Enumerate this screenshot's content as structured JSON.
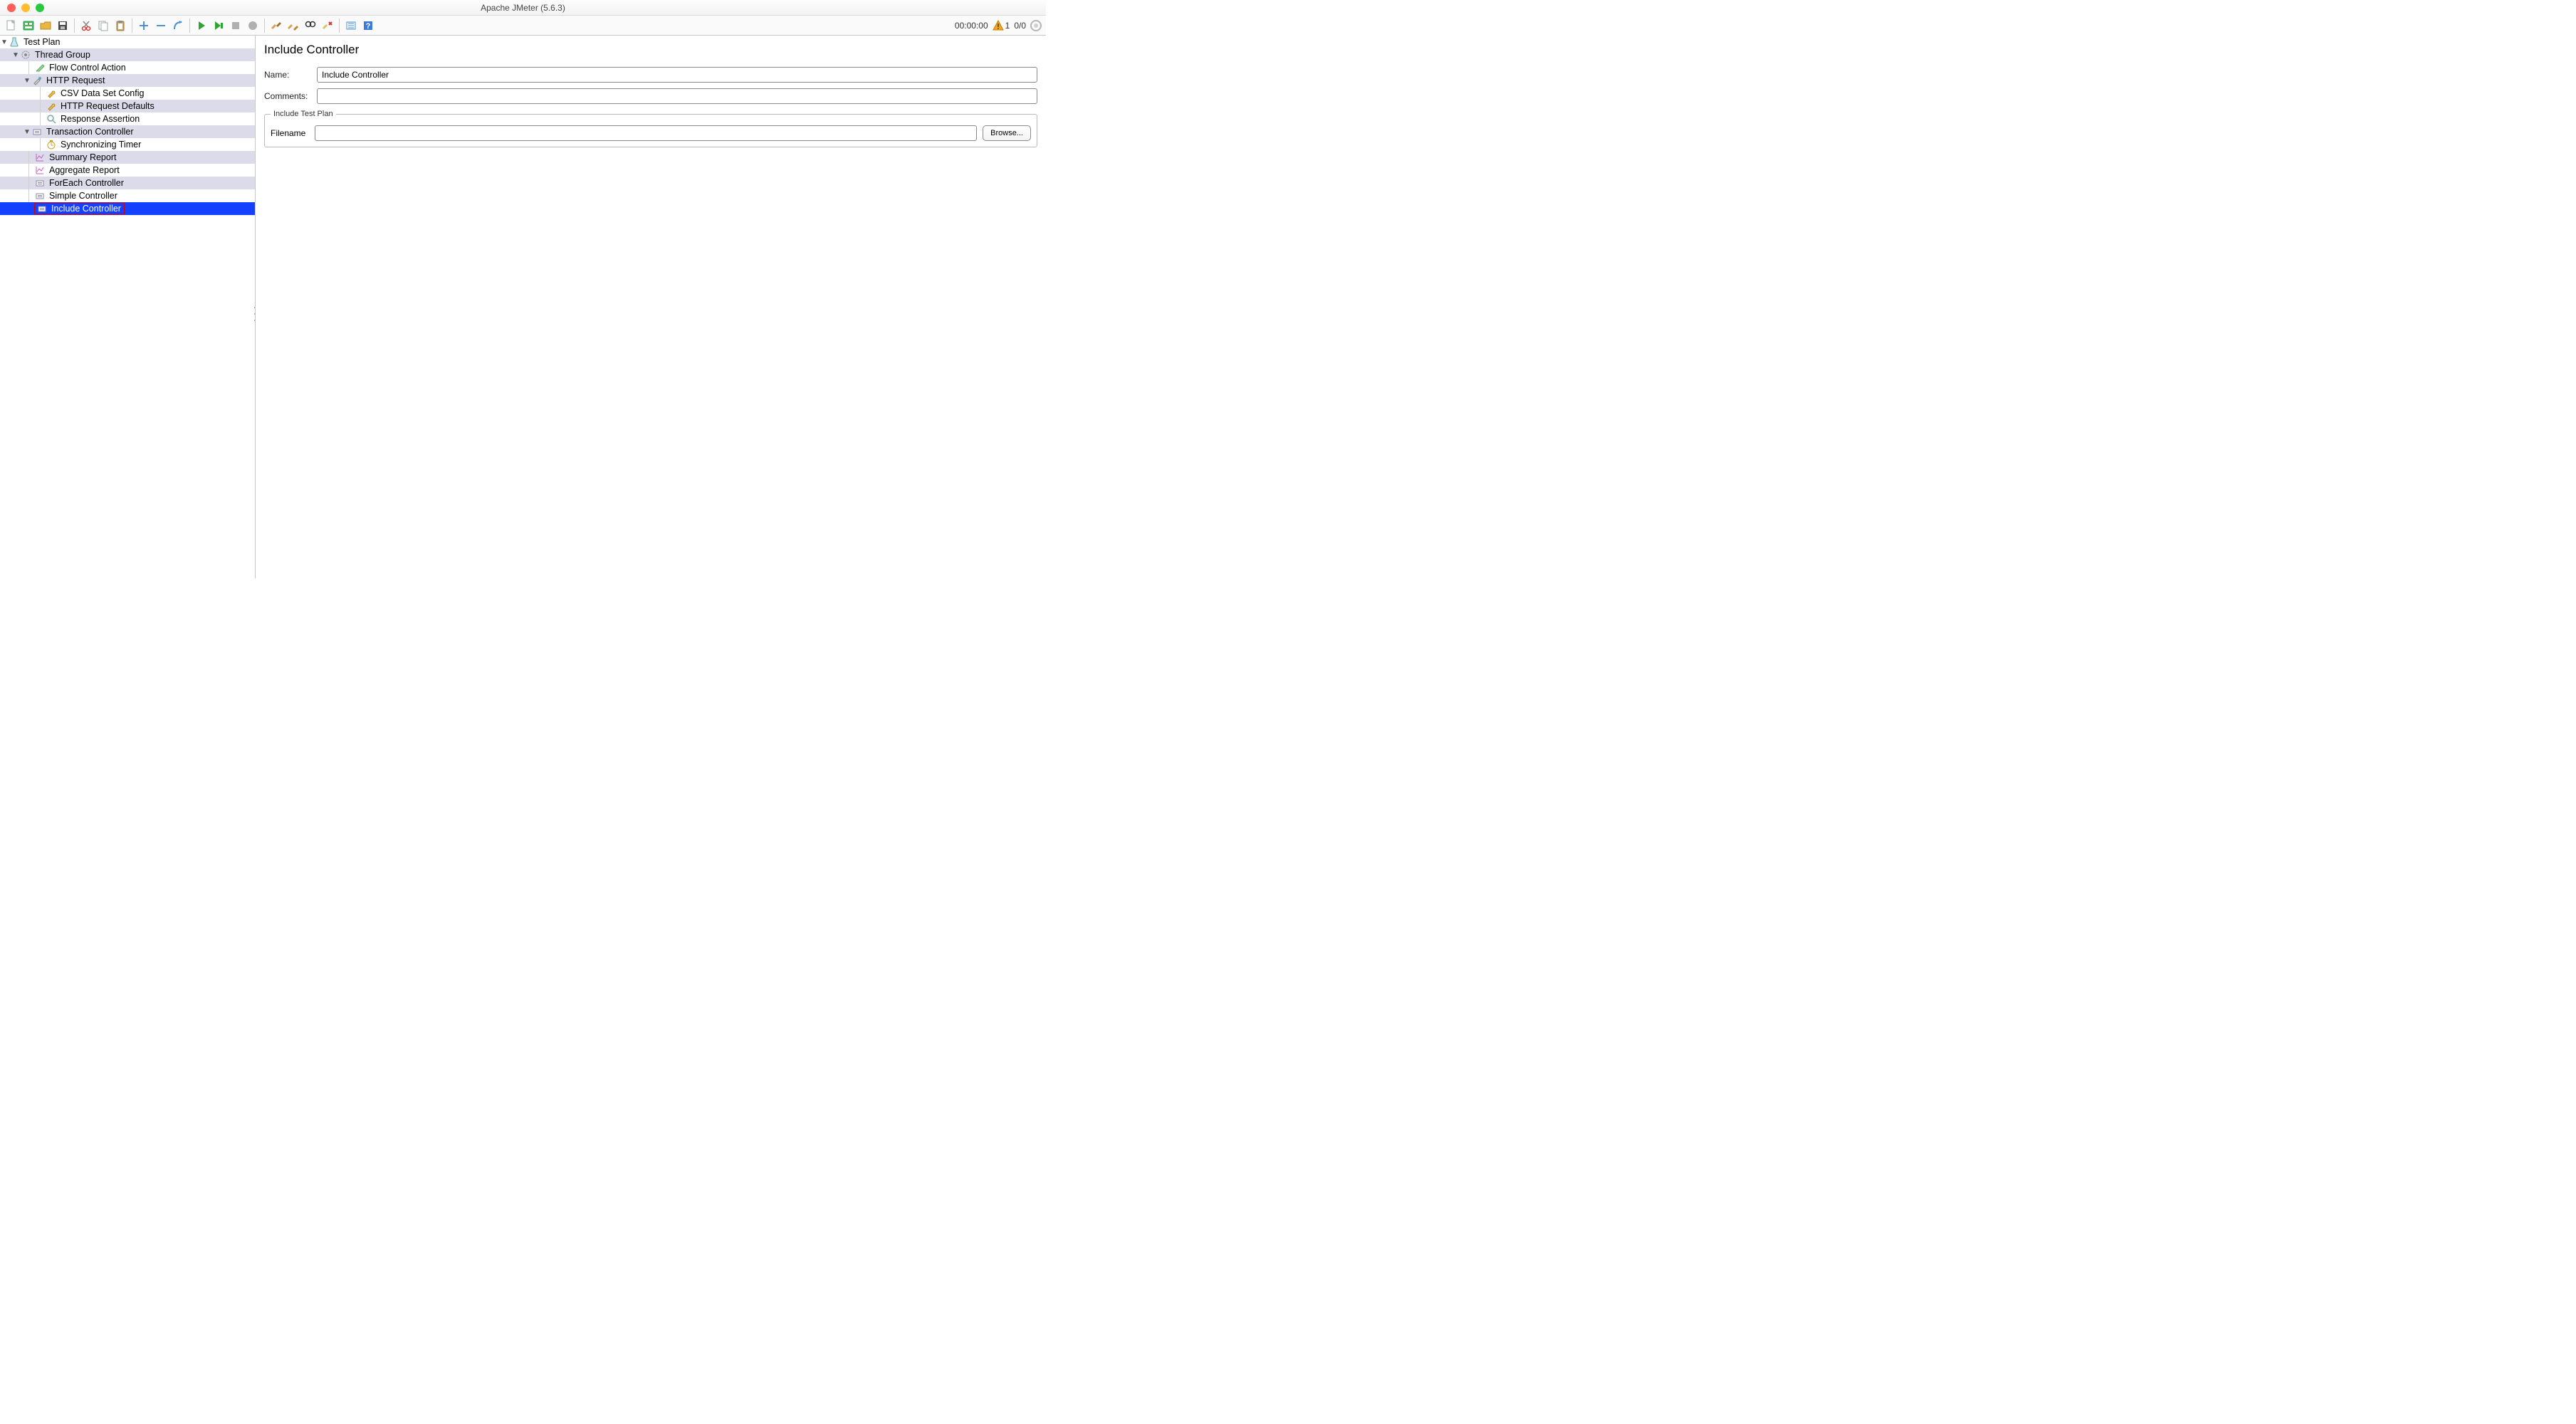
{
  "window": {
    "title": "Apache JMeter (5.6.3)"
  },
  "toolbar": {
    "timer": "00:00:00",
    "warning_count": "1",
    "thread_count": "0/0"
  },
  "tree": {
    "test_plan": "Test Plan",
    "thread_group": "Thread Group",
    "flow_control": "Flow Control Action",
    "http_request": "HTTP Request",
    "csv_config": "CSV Data Set Config",
    "http_defaults": "HTTP Request Defaults",
    "response_assertion": "Response Assertion",
    "transaction_controller": "Transaction Controller",
    "sync_timer": "Synchronizing Timer",
    "summary_report": "Summary Report",
    "aggregate_report": "Aggregate Report",
    "foreach_controller": "ForEach Controller",
    "simple_controller": "Simple Controller",
    "include_controller": "Include Controller"
  },
  "panel": {
    "title": "Include Controller",
    "name_label": "Name:",
    "name_value": "Include Controller",
    "comments_label": "Comments:",
    "comments_value": "",
    "fieldset_legend": "Include Test Plan",
    "filename_label": "Filename",
    "filename_value": "",
    "browse_label": "Browse..."
  }
}
